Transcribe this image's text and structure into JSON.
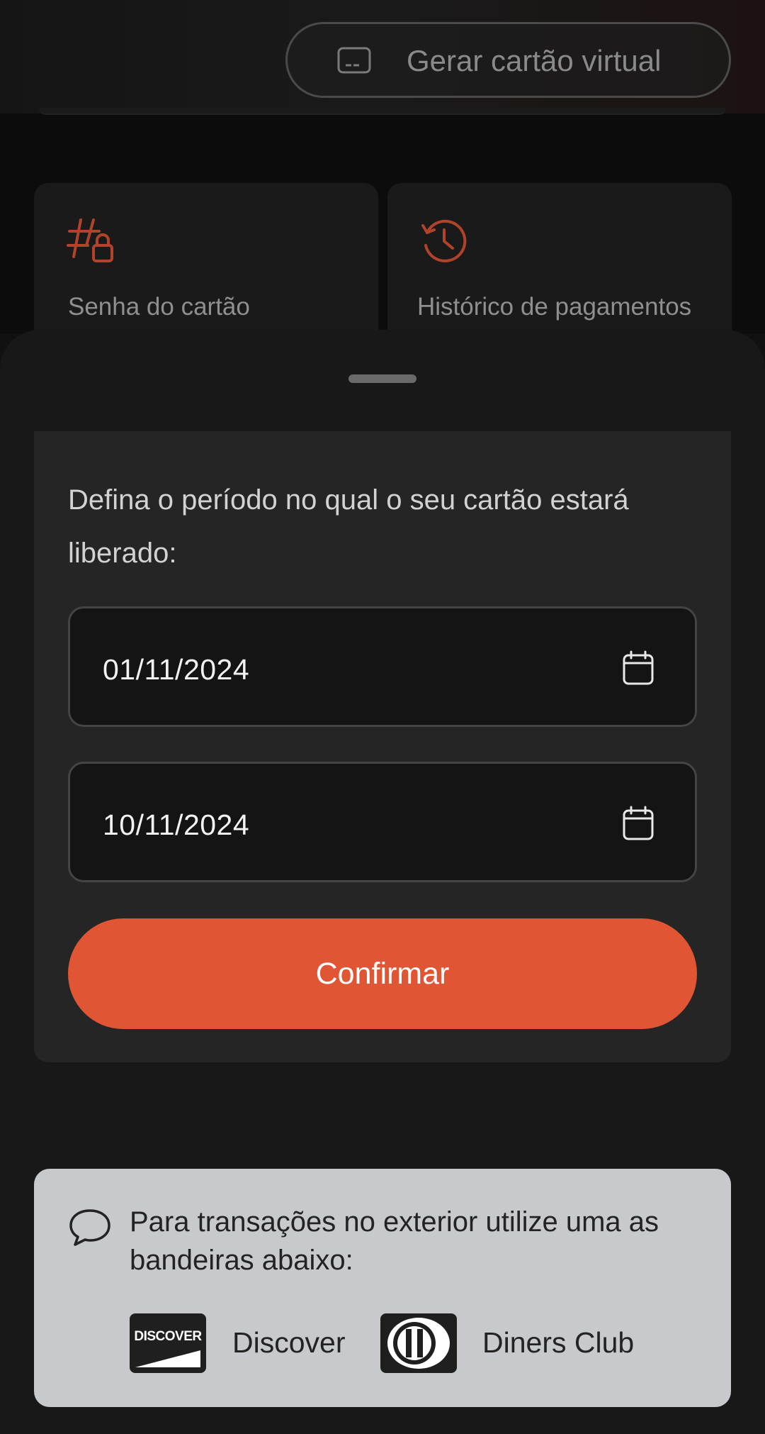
{
  "background": {
    "virtual_card_button": {
      "label": "Gerar cartão virtual",
      "icon": "card-icon"
    },
    "tiles": [
      {
        "label": "Senha do cartão",
        "icon": "hash-lock-icon"
      },
      {
        "label": "Histórico de pagamentos",
        "icon": "history-icon"
      }
    ],
    "accent_color": "#e05533"
  },
  "sheet": {
    "prompt": "Defina o período no qual o seu cartão estará liberado:",
    "start_date": {
      "value": "01/11/2024",
      "icon": "calendar-icon"
    },
    "end_date": {
      "value": "10/11/2024",
      "icon": "calendar-icon"
    },
    "confirm_label": "Confirmar",
    "confirm_color": "#e05533"
  },
  "international": {
    "icon": "chat-bubble-icon",
    "text": "Para transações no exterior utilize uma as bandeiras abaixo:",
    "brands": [
      {
        "name": "Discover",
        "logo_text": "DISCOVER"
      },
      {
        "name": "Diners Club"
      }
    ]
  }
}
